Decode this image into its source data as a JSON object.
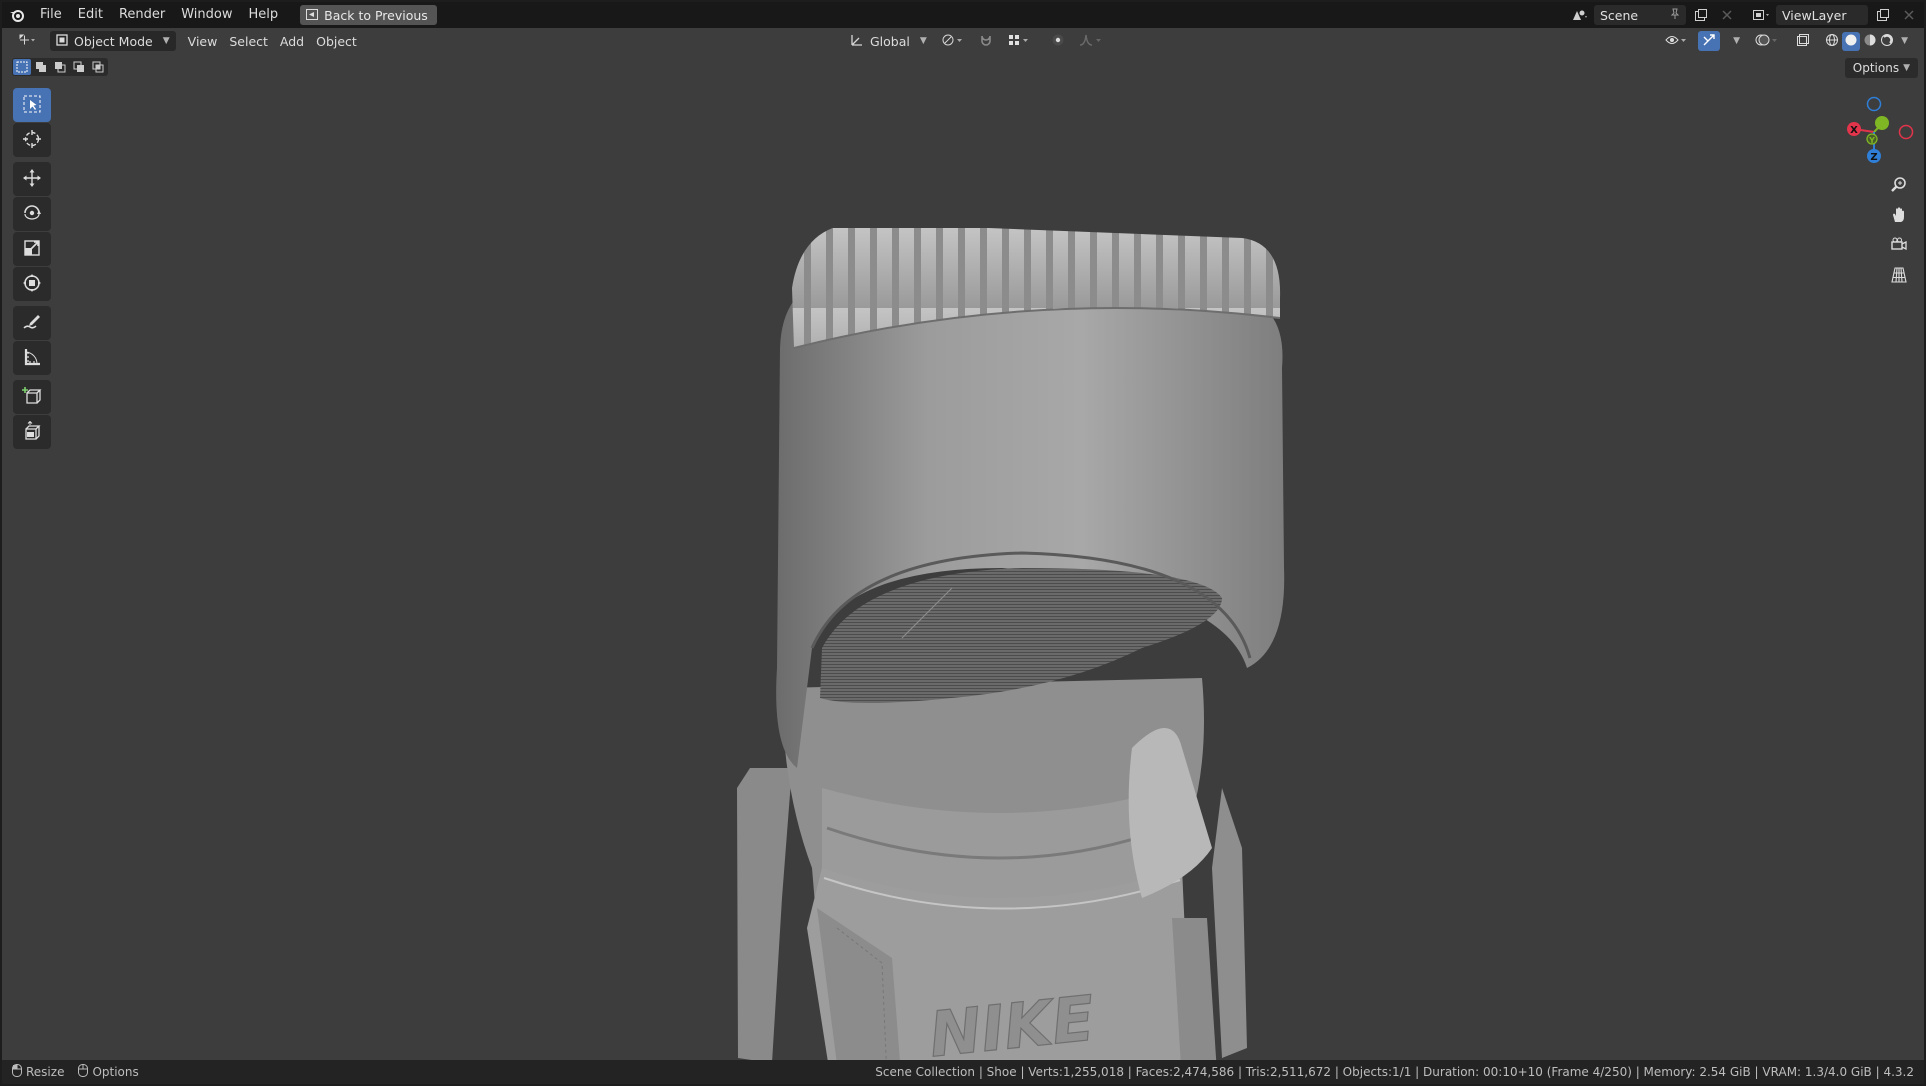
{
  "menubar": {
    "items": [
      "File",
      "Edit",
      "Render",
      "Window",
      "Help"
    ],
    "back_button": "Back to Previous"
  },
  "topright": {
    "scene_label": "Scene",
    "viewlayer_label": "ViewLayer"
  },
  "header": {
    "mode": "Object Mode",
    "menus": [
      "View",
      "Select",
      "Add",
      "Object"
    ],
    "orientation": "Global",
    "options_label": "Options"
  },
  "toolbar": {
    "tools": [
      "select-box",
      "cursor",
      "move",
      "rotate",
      "scale",
      "transform",
      "annotate",
      "measure",
      "add-cube",
      "extrude"
    ]
  },
  "gizmo": {
    "x_label": "X",
    "y_label": "Y",
    "z_label": "Z"
  },
  "model": {
    "logo_text": "NIKE"
  },
  "statusbar": {
    "left": [
      "Resize",
      "Options"
    ],
    "right": "Scene Collection | Shoe | Verts:1,255,018 | Faces:2,474,586 | Tris:2,511,672 | Objects:1/1 | Duration: 00:10+10 (Frame 4/250) | Memory: 2.54 GiB | VRAM: 1.3/4.0 GiB | 4.3.2"
  },
  "colors": {
    "accent": "#4772b3",
    "viewport_bg": "#3d3d3d",
    "axis_x": "#e2344b",
    "axis_y": "#7fb624",
    "axis_z": "#2f7fd8"
  }
}
